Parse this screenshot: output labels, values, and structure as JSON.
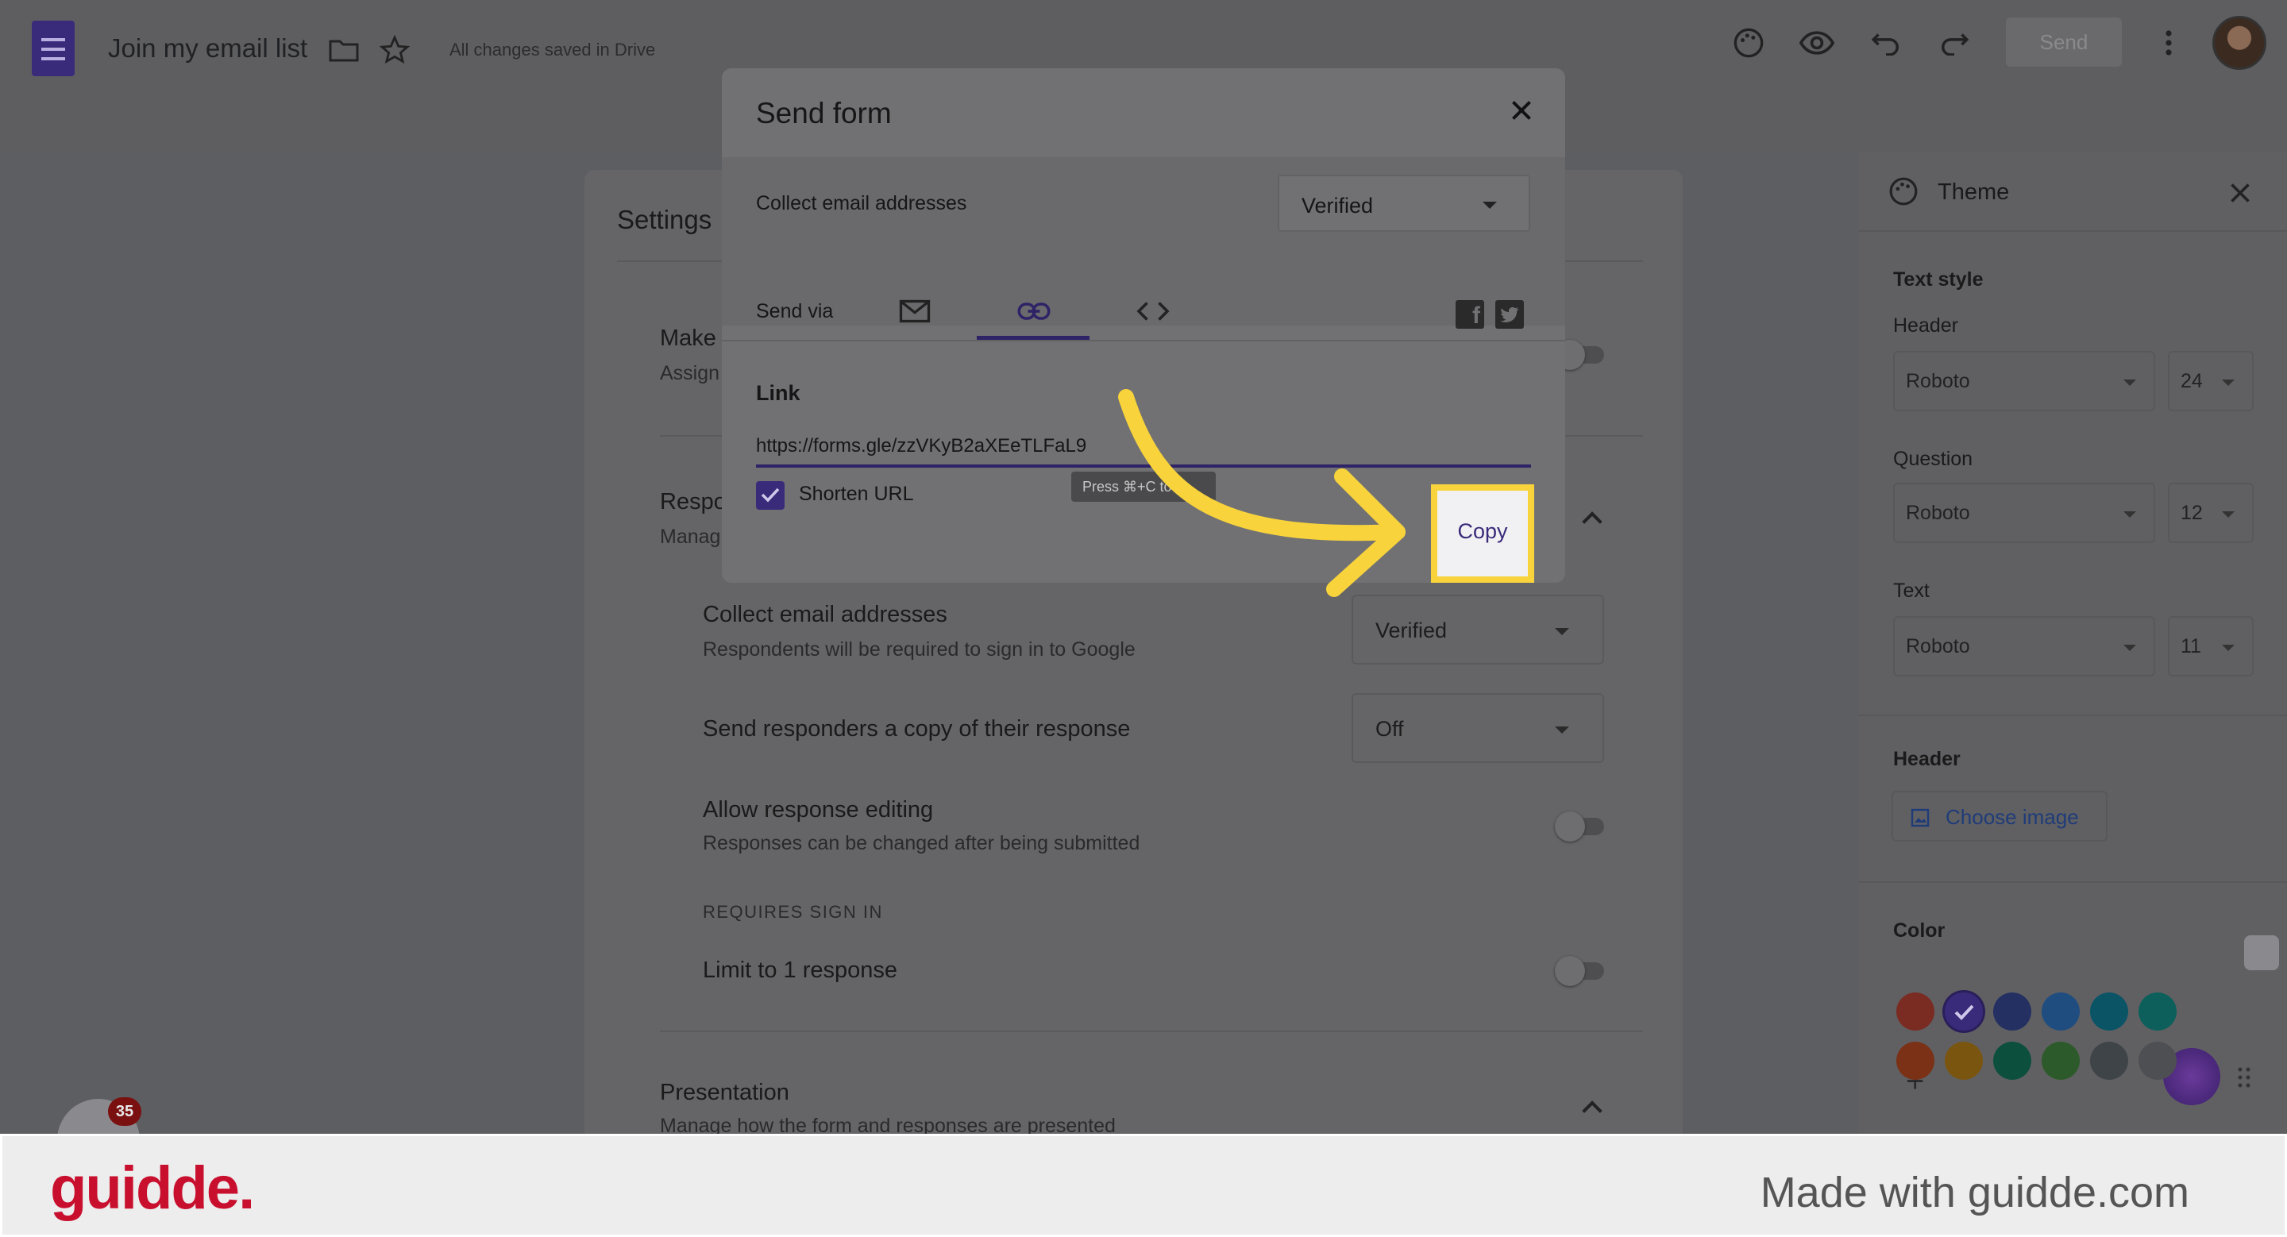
{
  "header": {
    "doc_title": "Join my email list",
    "saved_status": "All changes saved in Drive",
    "send_label": "Send",
    "icons": [
      "forms-logo-icon",
      "folder-icon",
      "star-icon",
      "palette-icon",
      "eye-icon",
      "undo-icon",
      "redo-icon",
      "more-vert-icon",
      "avatar"
    ]
  },
  "settings": {
    "title": "Settings",
    "make_quiz_label": "Make",
    "make_quiz_sub": "Assign",
    "responses_label": "Respo",
    "responses_sub": "Manag",
    "collect_email": {
      "label": "Collect email addresses",
      "sub": "Respondents will be required to sign in to Google",
      "value": "Verified"
    },
    "send_copy": {
      "label": "Send responders a copy of their response",
      "value": "Off"
    },
    "allow_edit": {
      "label": "Allow response editing",
      "sub": "Responses can be changed after being submitted"
    },
    "requires_sign_in": "REQUIRES SIGN IN",
    "limit_one": {
      "label": "Limit to 1 response"
    },
    "presentation": {
      "label": "Presentation",
      "sub": "Manage how the form and responses are presented"
    }
  },
  "theme": {
    "title": "Theme",
    "text_style": "Text style",
    "header_label": "Header",
    "header_font": "Roboto",
    "header_size": "24",
    "question_label": "Question",
    "question_font": "Roboto",
    "question_size": "12",
    "text_label": "Text",
    "text_font": "Roboto",
    "text_size": "11",
    "header_section": "Header",
    "choose_image": "Choose image",
    "color_label": "Color",
    "swatches_row1": [
      "#7a2b22",
      "#3a2a7a",
      "#233061",
      "#1f4d80",
      "#0a5466",
      "#0c5f5a"
    ],
    "swatches_row2": [
      "#7a3115",
      "#7a5510",
      "#0d4f3d",
      "#2d5a2a",
      "#3f4449",
      "#4e4f52"
    ],
    "selected_color": "#3a2a7a"
  },
  "modal": {
    "title": "Send form",
    "collect_label": "Collect email addresses",
    "collect_value": "Verified",
    "send_via": "Send via",
    "tabs": [
      "email-icon",
      "link-icon",
      "embed-icon"
    ],
    "active_tab": "link-icon",
    "link_heading": "Link",
    "link_url": "https://forms.gle/zzVKyB2aXEeTLFaL9",
    "shorten_url": "Shorten URL",
    "tooltip": "Press ⌘+C to",
    "copy_label": "Copy"
  },
  "badge_count": "35",
  "footer": {
    "brand": "guidde.",
    "made_with": "Made with guidde.com"
  },
  "colors": {
    "accent": "#3a2a7a",
    "highlight": "#f8d33b",
    "brand_red": "#c8102e"
  }
}
